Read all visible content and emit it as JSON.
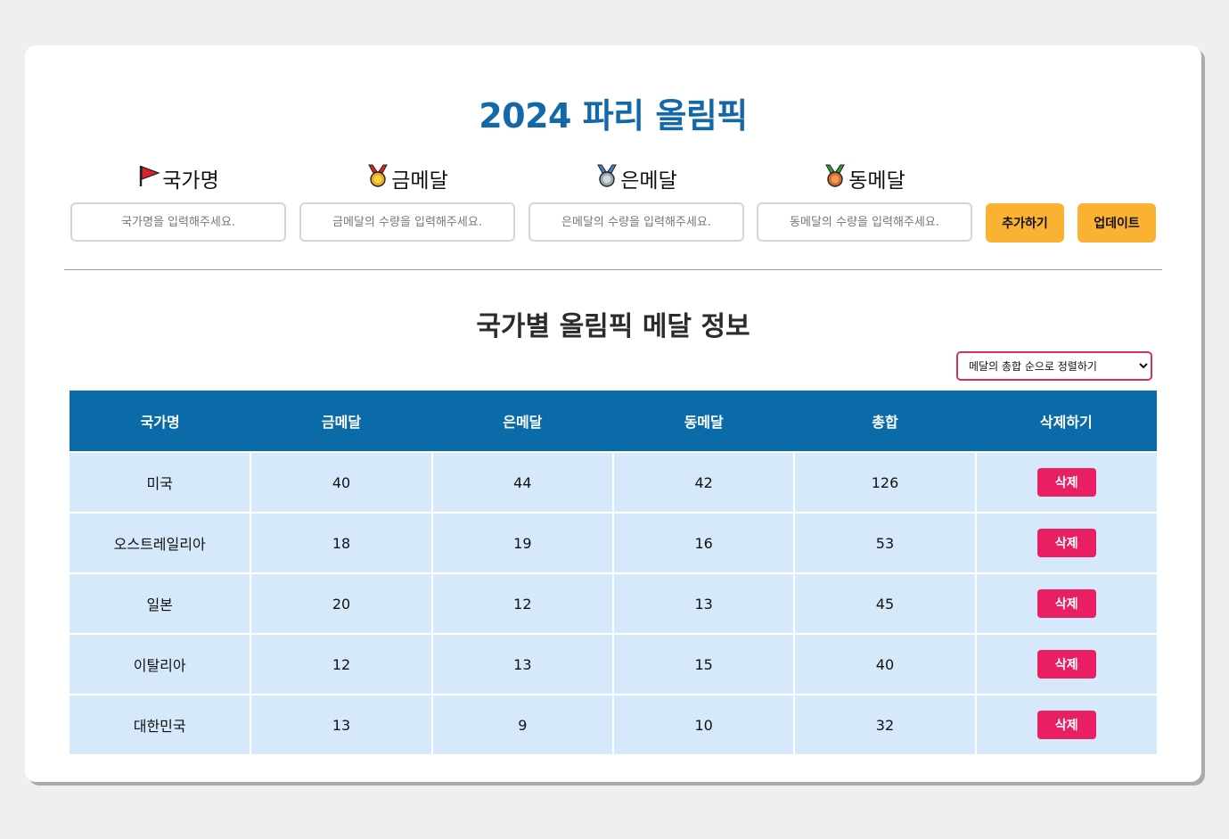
{
  "header": {
    "title": "2024 파리 올림픽"
  },
  "form": {
    "fields": [
      {
        "label": "국가명",
        "icon": "flag-icon",
        "placeholder": "국가명을 입력해주세요."
      },
      {
        "label": "금메달",
        "icon": "gold-medal-icon",
        "placeholder": "금메달의 수량을 입력해주세요."
      },
      {
        "label": "은메달",
        "icon": "silver-medal-icon",
        "placeholder": "은메달의 수량을 입력해주세요."
      },
      {
        "label": "동메달",
        "icon": "bronze-medal-icon",
        "placeholder": "동메달의 수량을 입력해주세요."
      }
    ],
    "add_label": "추가하기",
    "update_label": "업데이트"
  },
  "section": {
    "title": "국가별 올림픽 메달 정보"
  },
  "sort": {
    "selected": "메달의 총합 순으로 정렬하기"
  },
  "table": {
    "headers": [
      "국가명",
      "금메달",
      "은메달",
      "동메달",
      "총합",
      "삭제하기"
    ],
    "rows": [
      {
        "country": "미국",
        "gold": "40",
        "silver": "44",
        "bronze": "42",
        "total": "126",
        "action": "삭제"
      },
      {
        "country": "오스트레일리아",
        "gold": "18",
        "silver": "19",
        "bronze": "16",
        "total": "53",
        "action": "삭제"
      },
      {
        "country": "일본",
        "gold": "20",
        "silver": "12",
        "bronze": "13",
        "total": "45",
        "action": "삭제"
      },
      {
        "country": "이탈리아",
        "gold": "12",
        "silver": "13",
        "bronze": "15",
        "total": "40",
        "action": "삭제"
      },
      {
        "country": "대한민국",
        "gold": "13",
        "silver": "9",
        "bronze": "10",
        "total": "32",
        "action": "삭제"
      }
    ]
  },
  "colors": {
    "title": "#1368a8",
    "header_bg": "#0a6ba8",
    "row_bg": "#d5e9fb",
    "button": "#fbb233",
    "delete": "#e91e63",
    "select_border": "#d0325e"
  }
}
